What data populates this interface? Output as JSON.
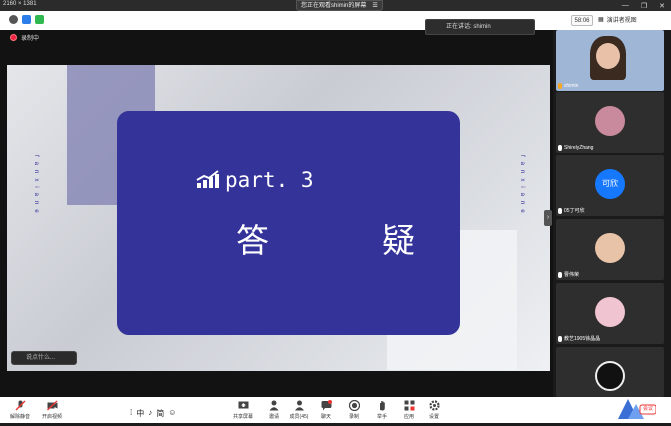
{
  "top": {
    "dimensions": "2160 × 1381",
    "viewing_banner": "您正在观看shimin的屏幕",
    "viewing_menu": "☰"
  },
  "titlebar": {
    "timer": "58:06",
    "view_mode": "演讲者视图",
    "speaking": "正在讲话: shimin"
  },
  "recording": {
    "label": "录制中"
  },
  "slide": {
    "part": "part. 3",
    "title": "答　疑",
    "side_left": "fanxiane",
    "side_right": "fanxiane"
  },
  "chat_preview": "说点什么...",
  "participants": [
    {
      "name": "shimin",
      "avatar_text": "",
      "color": "#6b8fbf"
    },
    {
      "name": "ShirelyZhang",
      "avatar_text": "",
      "color": "#c98a9e"
    },
    {
      "name": "05丁可欣",
      "avatar_text": "可欣",
      "color": "#1677ff"
    },
    {
      "name": "曹伟荣",
      "avatar_text": "",
      "color": "#e9c3a8"
    },
    {
      "name": "教艺1905徐晶晶",
      "avatar_text": "",
      "color": "#f1c4d2"
    },
    {
      "name": "",
      "avatar_text": "",
      "color": "#3b3b3b"
    }
  ],
  "toolbar": {
    "mute": "解除静音",
    "video": "开启视频",
    "ime": [
      "中",
      "♪",
      "简",
      "☺"
    ],
    "share": "共享屏幕",
    "invite": "邀请",
    "members": "成员(45)",
    "chat": "聊天",
    "record": "录制",
    "raise": "举手",
    "apps": "应用",
    "settings": "设置",
    "end": "会议"
  }
}
